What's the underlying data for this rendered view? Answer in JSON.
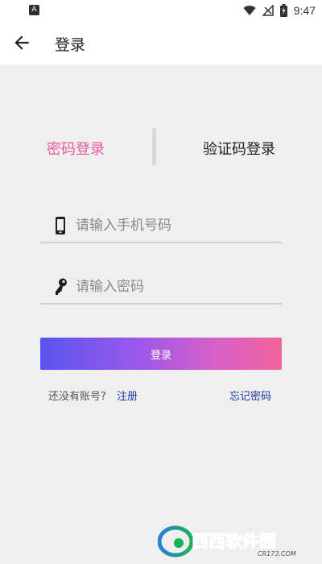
{
  "status_bar": {
    "app_icon": "A",
    "time": "9:47",
    "icons": [
      "wifi-icon",
      "signal-icon",
      "battery-icon"
    ]
  },
  "header": {
    "title": "登录",
    "back_icon": "arrow-left-icon"
  },
  "tabs": [
    {
      "label": "密码登录",
      "active": true
    },
    {
      "label": "验证码登录",
      "active": false
    }
  ],
  "form": {
    "phone_placeholder": "请输入手机号码",
    "phone_value": "",
    "password_placeholder": "请输入密码",
    "password_value": "",
    "login_label": "登录"
  },
  "links": {
    "no_account": "还没有账号?",
    "register": "注册",
    "forgot": "忘记密码"
  },
  "watermark": {
    "name": "西西软件园",
    "site": "CR173.COM"
  },
  "colors": {
    "accent": "#ec5a9c",
    "link": "#1c34a8",
    "gradient_start": "#5a55f0",
    "gradient_end": "#f2649c",
    "background": "#efefef"
  }
}
